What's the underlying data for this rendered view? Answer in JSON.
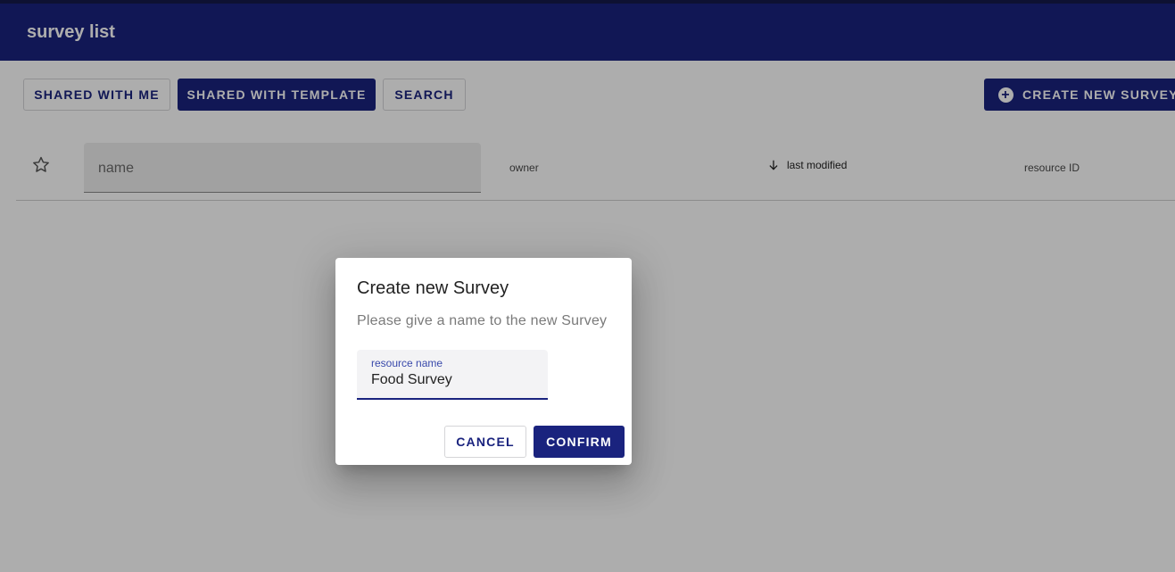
{
  "app": {
    "title": "survey list"
  },
  "toolbar": {
    "shared_with_me": "SHARED WITH ME",
    "shared_with_template": "SHARED WITH TEMPLATE",
    "search": "SEARCH",
    "create_new_survey": "CREATE NEW SURVEY",
    "create_icon": "add-circle-icon"
  },
  "table": {
    "favorite_icon": "star-outline-icon",
    "name_filter_placeholder": "name",
    "columns": {
      "owner": "owner",
      "last_modified": "last modified",
      "resource_id": "resource ID"
    },
    "sort_icon": "arrow-down-icon"
  },
  "dialog": {
    "title": "Create new Survey",
    "message": "Please give a name to the new Survey",
    "field_label": "resource name",
    "field_value": "Food Survey",
    "cancel": "CANCEL",
    "confirm": "CONFIRM"
  },
  "colors": {
    "primary": "#1a237e",
    "accent_label": "#3949ab",
    "overlay": "rgba(0,0,0,0.32)"
  }
}
